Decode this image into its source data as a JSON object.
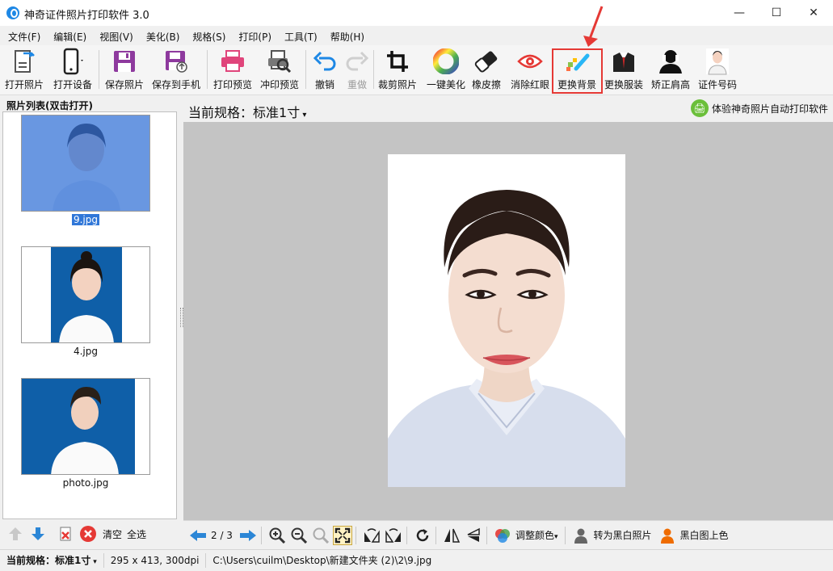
{
  "window": {
    "title": "神奇证件照片打印软件 3.0",
    "minimize": "—",
    "maximize": "☐",
    "close": "✕"
  },
  "menu": [
    "文件(F)",
    "编辑(E)",
    "视图(V)",
    "美化(B)",
    "规格(S)",
    "打印(P)",
    "工具(T)",
    "帮助(H)"
  ],
  "toolbar": {
    "open_photo": "打开照片",
    "open_device": "打开设备",
    "save_photo": "保存照片",
    "save_to_phone": "保存到手机",
    "print_preview": "打印预览",
    "develop_preview": "冲印预览",
    "undo": "撤销",
    "redo": "重做",
    "crop": "裁剪照片",
    "auto_beautify": "一键美化",
    "eraser": "橡皮擦",
    "red_eye": "消除红眼",
    "change_bg": "更换背景",
    "change_clothes": "更换服装",
    "fix_shoulder": "矫正肩高",
    "id_number": "证件号码"
  },
  "left_panel": {
    "header": "照片列表(双击打开)",
    "photos": [
      {
        "name": "9.jpg",
        "selected": true
      },
      {
        "name": "4.jpg",
        "selected": false
      },
      {
        "name": "photo.jpg",
        "selected": false
      }
    ],
    "clear": "清空",
    "select_all": "全选"
  },
  "main": {
    "spec_prefix": "当前规格：",
    "spec_value": "标准1寸",
    "try_link": "体验神奇照片自动打印软件"
  },
  "bottom_bar": {
    "page": "2 / 3",
    "adjust_color": "调整颜色",
    "to_bw": "转为黑白照片",
    "colorize": "黑白图上色"
  },
  "status": {
    "spec_label": "当前规格：",
    "spec_value": "标准1寸",
    "size": "295 x 413, 300dpi",
    "path": "C:\\Users\\cuilm\\Desktop\\新建文件夹 (2)\\2\\9.jpg"
  },
  "colors": {
    "id_blue": "#0f5fa8",
    "selection_blue": "#3077d8",
    "highlight_red": "#e53935",
    "canvas_gray": "#c4c4c4"
  }
}
